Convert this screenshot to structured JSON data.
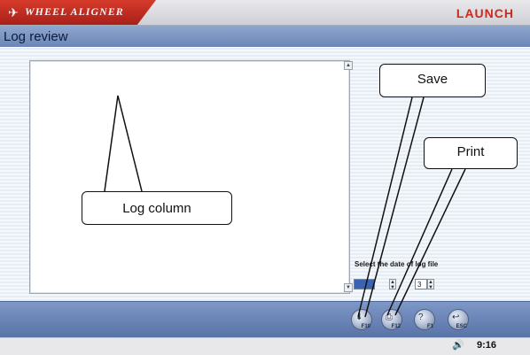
{
  "header": {
    "brand": "WHEEL ALIGNER",
    "vendor": "LAUNCH"
  },
  "title_bar": {
    "title": "Log review"
  },
  "date_selector": {
    "label": "Select the date of log file",
    "field1_value": "",
    "field2_value": "3"
  },
  "toolbar": {
    "buttons": [
      {
        "key": "F10",
        "icon": "save-icon"
      },
      {
        "key": "F12",
        "icon": "print-icon"
      },
      {
        "key": "F1",
        "icon": "help-icon"
      },
      {
        "key": "ESC",
        "icon": "exit-icon"
      }
    ]
  },
  "status_bar": {
    "time": "9:16"
  },
  "callouts": {
    "log_column": "Log column",
    "save": "Save",
    "print": "Print"
  }
}
